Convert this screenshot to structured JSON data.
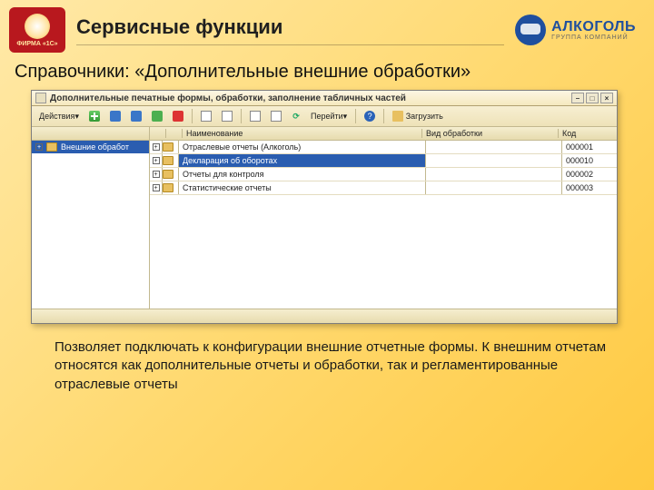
{
  "header": {
    "logo_1c_subtext": "ФИРМА «1С»",
    "page_title": "Сервисные функции",
    "alco_brand": "АЛКОГОЛЬ",
    "alco_sub": "ГРУППА КОМПАНИЙ"
  },
  "subtitle": "Справочники: «Дополнительные внешние обработки»",
  "window": {
    "title": "Дополнительные печатные формы, обработки, заполнение табличных частей",
    "toolbar": {
      "actions": "Действия",
      "goto": "Перейти",
      "load": "Загрузить"
    },
    "tree": {
      "header": "",
      "root": "Внешние обработ"
    },
    "grid": {
      "headers": {
        "name": "Наименование",
        "type": "Вид обработки",
        "code": "Код"
      },
      "rows": [
        {
          "name": "Отраслевые отчеты (Алкоголь)",
          "type": "",
          "code": "000001"
        },
        {
          "name": "Декларация об оборотах",
          "type": "",
          "code": "000010",
          "selected": true
        },
        {
          "name": "Отчеты для контроля",
          "type": "",
          "code": "000002"
        },
        {
          "name": "Статистические отчеты",
          "type": "",
          "code": "000003"
        }
      ]
    }
  },
  "caption": "Позволяет подключать к конфигурации внешние отчетные формы. К внешним отчетам относятся как дополнительные отчеты и обработки, так и регламентированные отраслевые отчеты"
}
